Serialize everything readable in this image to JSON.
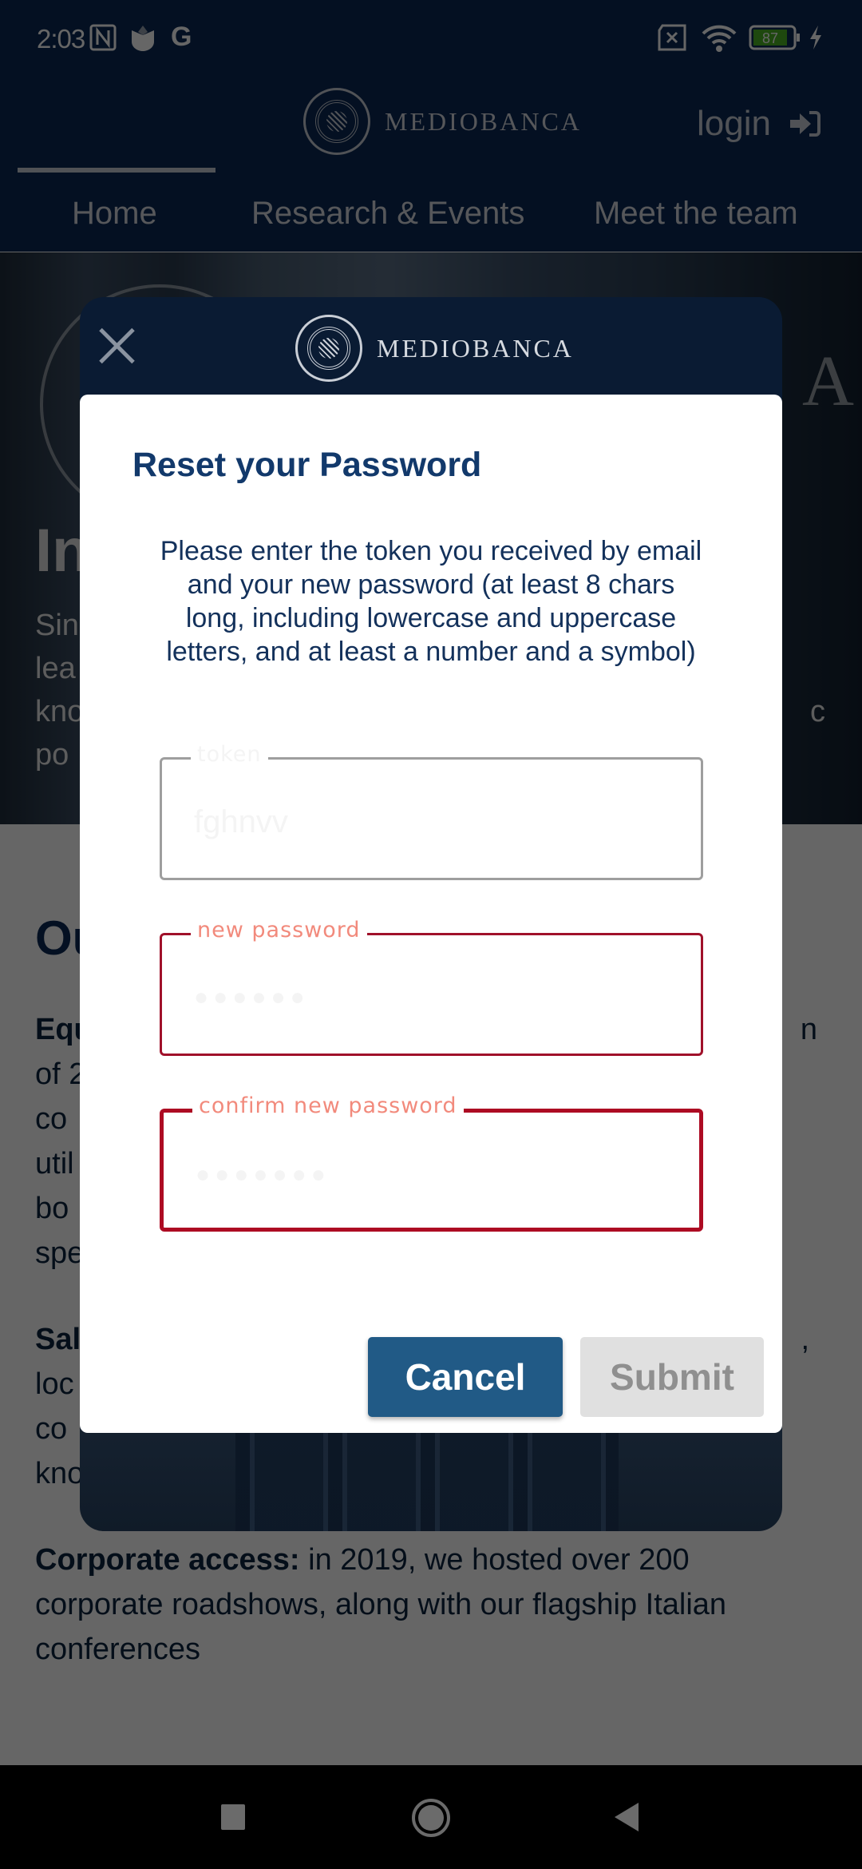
{
  "status_bar": {
    "time": "2:03",
    "left_icons": [
      "nfc-icon",
      "shield-app-icon",
      "google-icon"
    ],
    "right_icons": [
      "sim-missing-icon",
      "wifi-icon",
      "battery-icon",
      "charging-icon"
    ],
    "battery_level": "87"
  },
  "header": {
    "brand": "MEDIOBANCA",
    "login_label": "login",
    "login_icon": "sign-in-icon",
    "tabs": [
      {
        "label": "Home",
        "active": true
      },
      {
        "label": "Research & Events",
        "active": false
      },
      {
        "label": "Meet the team",
        "active": false
      }
    ]
  },
  "hero": {
    "title_partial": "In",
    "text_lines": [
      "Sinc",
      "lea",
      "kno",
      "po"
    ],
    "right_fragment": "c",
    "watermark_letter": "A"
  },
  "content": {
    "section_title_partial": "Ou",
    "paragraphs": [
      {
        "bold": "Equ",
        "lines": [
          "of 2",
          "co",
          "util",
          "bo",
          "spe"
        ],
        "right_fragment": "n"
      },
      {
        "bold": "Sal",
        "lines": [
          "loc",
          "co",
          "kno"
        ],
        "right_fragment": ","
      },
      {
        "bold": "Corporate access:",
        "text": " in 2019, we hosted over 200 corporate roadshows, along with our flagship Italian conferences"
      }
    ]
  },
  "login_modal": {
    "brand": "MEDIOBANCA",
    "close_icon": "close-icon"
  },
  "reset_dialog": {
    "title": "Reset your Password",
    "description": "Please enter the token you received by email and your new password (at least 8 chars long, including lowercase and uppercase letters, and at least a number and a symbol)",
    "fields": [
      {
        "label": "token",
        "value": "fghnvv",
        "type": "text",
        "state": "normal"
      },
      {
        "label": "new password",
        "value": "●●●●●●",
        "type": "password",
        "state": "error"
      },
      {
        "label": "confirm new password",
        "value": "●●●●●●●",
        "type": "password",
        "state": "error"
      }
    ],
    "cancel_label": "Cancel",
    "submit_label": "Submit",
    "submit_enabled": false
  },
  "colors": {
    "brand_navy": "#0b2a55",
    "dialog_title": "#12396b",
    "cancel_button": "#215a86",
    "submit_disabled": "#e0e0e0",
    "error_border": "#a0112a",
    "error_label": "#f28a7c"
  },
  "nav_bar": {
    "buttons": [
      "recents-icon",
      "home-icon",
      "back-icon"
    ]
  }
}
